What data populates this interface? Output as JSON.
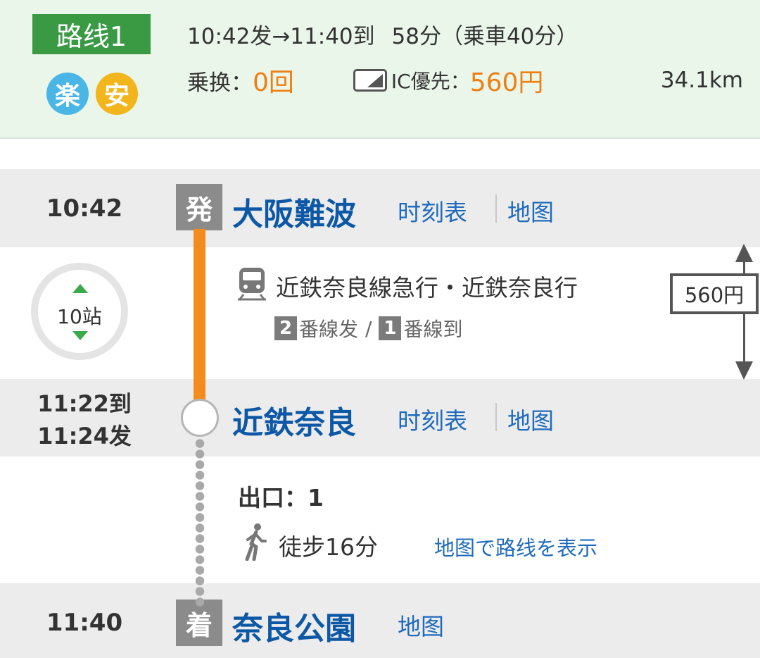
{
  "summary": {
    "route_label": "路线1",
    "badges": [
      "楽",
      "安"
    ],
    "times": "10:42发→11:40到",
    "duration": "58分（乗車40分）",
    "transfer_label": "乗换：",
    "transfer_count": "0回",
    "ic_label": "IC優先：",
    "fare": "560円",
    "distance": "34.1km"
  },
  "departure": {
    "time": "10:42",
    "marker": "発",
    "station": "大阪難波",
    "timetable_link": "时刻表",
    "map_link": "地图"
  },
  "train_segment": {
    "stops": "10站",
    "line_name": "近鉄奈良線急行・近鉄奈良行",
    "dep_platform": "2",
    "dep_platform_label": "番線发",
    "platform_sep": "/",
    "arr_platform": "1",
    "arr_platform_label": "番線到",
    "fare": "560円"
  },
  "transfer_station": {
    "arrive_time": "11:22到",
    "depart_time": "11:24发",
    "station": "近鉄奈良",
    "timetable_link": "时刻表",
    "map_link": "地图"
  },
  "walk_segment": {
    "exit": "出口：1",
    "walk": "徒步16分",
    "map_route_link": "地图で路线を表示"
  },
  "arrival": {
    "time": "11:40",
    "marker": "着",
    "station": "奈良公園",
    "map_link": "地图"
  },
  "colors": {
    "header_bg": "#eaf6ea",
    "route_label_bg": "#3a9a44",
    "station_name": "#0d58a6",
    "link": "#1f6bbd",
    "fare_orange": "#f07f12",
    "train_line": "#f28c1c"
  }
}
